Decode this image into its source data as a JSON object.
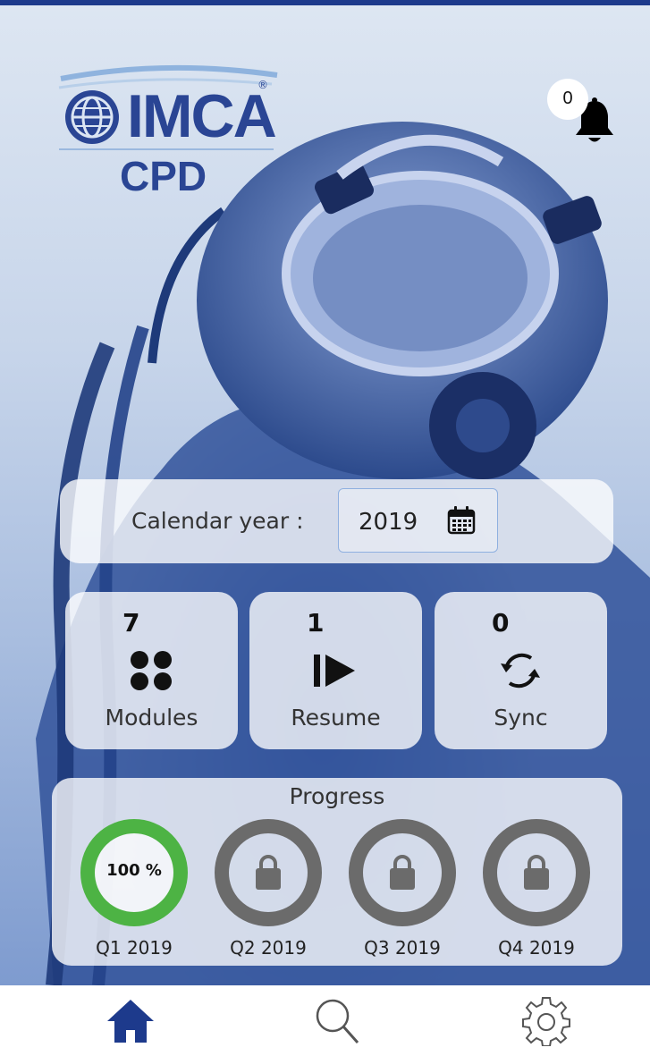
{
  "header": {
    "logo_text": "IMCA",
    "logo_reg": "®",
    "logo_sub": "CPD",
    "notification_count": "0"
  },
  "calendar": {
    "label": "Calendar year :",
    "year": "2019"
  },
  "tiles": [
    {
      "count": "7",
      "label": "Modules",
      "icon": "modules-dots-icon"
    },
    {
      "count": "1",
      "label": "Resume",
      "icon": "resume-play-icon"
    },
    {
      "count": "0",
      "label": "Sync",
      "icon": "sync-icon"
    }
  ],
  "progress": {
    "title": "Progress",
    "quarters": [
      {
        "label": "Q1 2019",
        "value": "100 %",
        "fraction": 1.0,
        "locked": false,
        "color": "#4db344"
      },
      {
        "label": "Q2 2019",
        "locked": true,
        "color": "#6b6b6b"
      },
      {
        "label": "Q3 2019",
        "locked": true,
        "color": "#6b6b6b"
      },
      {
        "label": "Q4 2019",
        "locked": true,
        "color": "#6b6b6b"
      }
    ]
  },
  "nav": {
    "items": [
      {
        "name": "home",
        "icon": "home-icon",
        "active": true,
        "color": "#1d3a8c"
      },
      {
        "name": "search",
        "icon": "search-icon",
        "active": false,
        "color": "#555555"
      },
      {
        "name": "settings",
        "icon": "gear-icon",
        "active": false,
        "color": "#555555"
      }
    ]
  },
  "colors": {
    "brand": "#2a4594",
    "accent": "#1d3a8c",
    "complete": "#4db344",
    "locked": "#6b6b6b"
  }
}
